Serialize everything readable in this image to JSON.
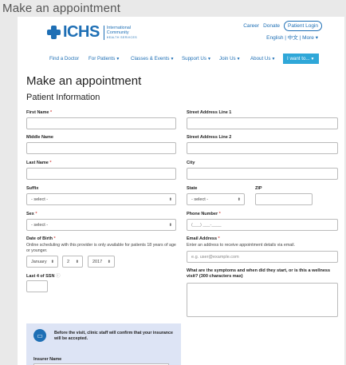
{
  "window_title": "Make an appointment",
  "header": {
    "logo_text": "ICHS",
    "logo_sub1": "International",
    "logo_sub2": "Community",
    "logo_sub3": "HEALTH SERVICES",
    "career": "Career",
    "donate": "Donate",
    "patient_login": "Patient Login",
    "english": "English",
    "chinese": "中文",
    "more": "More"
  },
  "nav": {
    "find_doctor": "Find a Doctor",
    "for_patients": "For Patients",
    "classes_events": "Classes & Events",
    "support_us": "Support Us",
    "join_us": "Join Us",
    "about_us": "About Us",
    "i_want_to": "I want to..."
  },
  "page_title": "Make an appointment",
  "section_title": "Patient Information",
  "form": {
    "first_name": "First Name",
    "middle_name": "Middle Name",
    "last_name": "Last Name",
    "suffix": "Suffix",
    "suffix_value": "- select -",
    "sex": "Sex",
    "sex_value": "- select -",
    "dob": "Date of Birth",
    "dob_hint": "Online scheduling with this provider is only available for patients 18 years of age or younger.",
    "dob_month": "January",
    "dob_day": "2",
    "dob_year": "2017",
    "ssn": "Last 4 of SSN",
    "street1": "Street Address Line 1",
    "street2": "Street Address Line 2",
    "city": "City",
    "state": "State",
    "state_value": "- select -",
    "zip": "ZIP",
    "phone": "Phone Number",
    "phone_placeholder": "(___) ___-____",
    "email": "Email Address",
    "email_hint": "Enter an address to receive appointment details via email.",
    "email_placeholder": "e.g. user@example.com",
    "symptoms": "What are the symptoms and when did they start, or is this a wellness visit? (300 characters max)",
    "required_mark": "*",
    "info_mark": "ⓘ"
  },
  "notice": {
    "text": "Before the visit, clinic staff will confirm that your insurance will be accepted.",
    "insurer_name": "Insurer Name"
  },
  "colors": {
    "brand": "#1e6fb5",
    "accent": "#2fa7d8",
    "required": "#d9534f",
    "notice_bg": "#dde4f5"
  }
}
